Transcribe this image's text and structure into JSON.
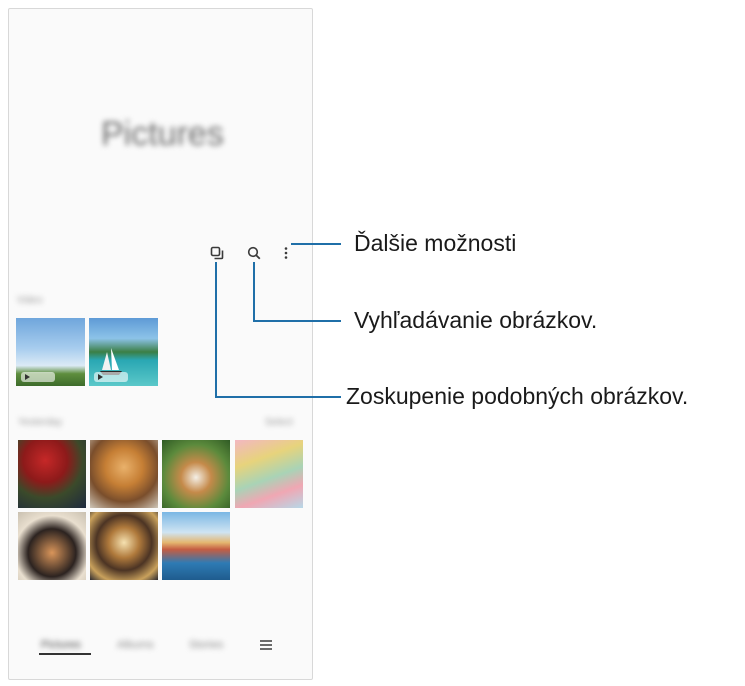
{
  "app": {
    "title": "Pictures"
  },
  "sections": {
    "videos_label": "Video",
    "yesterday_label": "Yesterday",
    "yesterday_action": "Select"
  },
  "nav": {
    "tabs": [
      "Pictures",
      "Albums",
      "Stories"
    ],
    "active_tab": "Pictures",
    "menu_icon": "hamburger-icon"
  },
  "toolbar": {
    "icons": [
      "group-similar-icon",
      "search-icon",
      "more-options-icon"
    ]
  },
  "callouts": {
    "more_options": "Ďalšie možnosti",
    "search": "Vyhľadávanie obrázkov.",
    "group_similar": "Zoskupenie podobných obrázkov."
  },
  "colors": {
    "callout_line": "#1f6fa8",
    "frame_border": "#d8d8d8"
  }
}
